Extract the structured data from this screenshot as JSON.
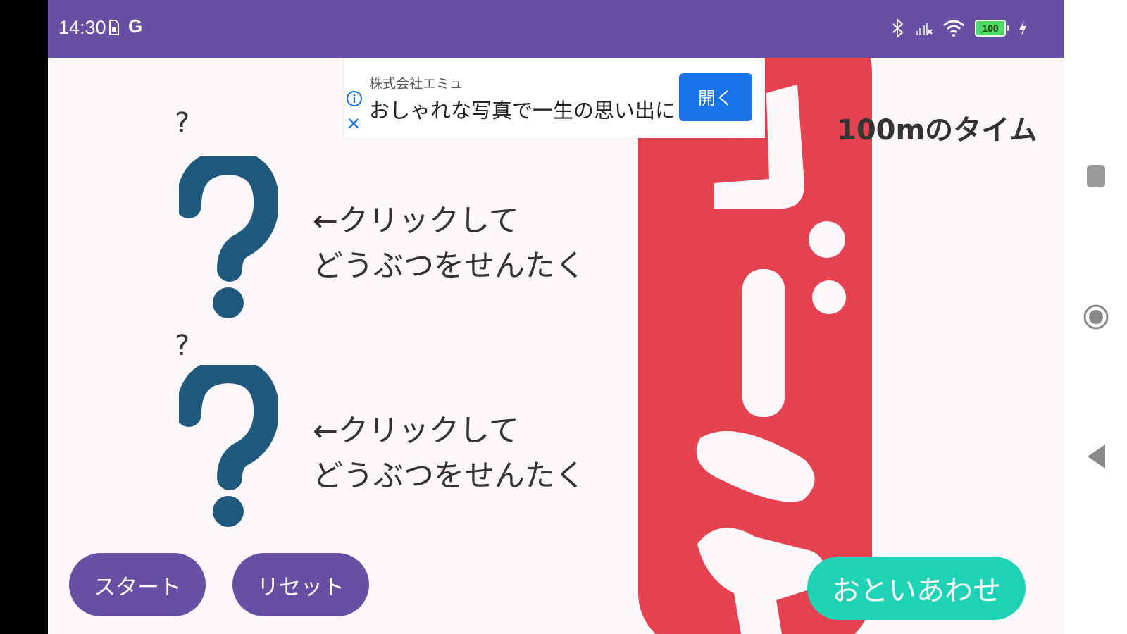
{
  "status_bar": {
    "time": "14:30",
    "sim_indicator": "G",
    "battery_level": "100",
    "background": "#6750A4"
  },
  "ad": {
    "advertiser": "株式会社エミュ",
    "headline": "おしゃれな写真で一生の思い出に",
    "open_label": "開く",
    "info_icon": "info-icon",
    "close_icon": "close-icon"
  },
  "title": "100mのタイム",
  "slots": [
    {
      "label": "?",
      "instruction_line1": "←クリックして",
      "instruction_line2": "どうぶつをせんたく",
      "icon": "question-mark-icon"
    },
    {
      "label": "?",
      "instruction_line1": "←クリックして",
      "instruction_line2": "どうぶつをせんたく",
      "icon": "question-mark-icon"
    }
  ],
  "buttons": {
    "start": "スタート",
    "reset": "リセット",
    "contact": "おといあわせ"
  },
  "background_image": {
    "name": "goal-stamp-image",
    "color": "#E5414E"
  },
  "colors": {
    "primary": "#6750A4",
    "accent": "#1ED2B5",
    "ad_button": "#1a73e8",
    "question_mark": "#1F5A7E"
  },
  "nav_bar": {
    "icons": [
      "square-icon",
      "home-circle-icon",
      "back-triangle-icon"
    ]
  }
}
